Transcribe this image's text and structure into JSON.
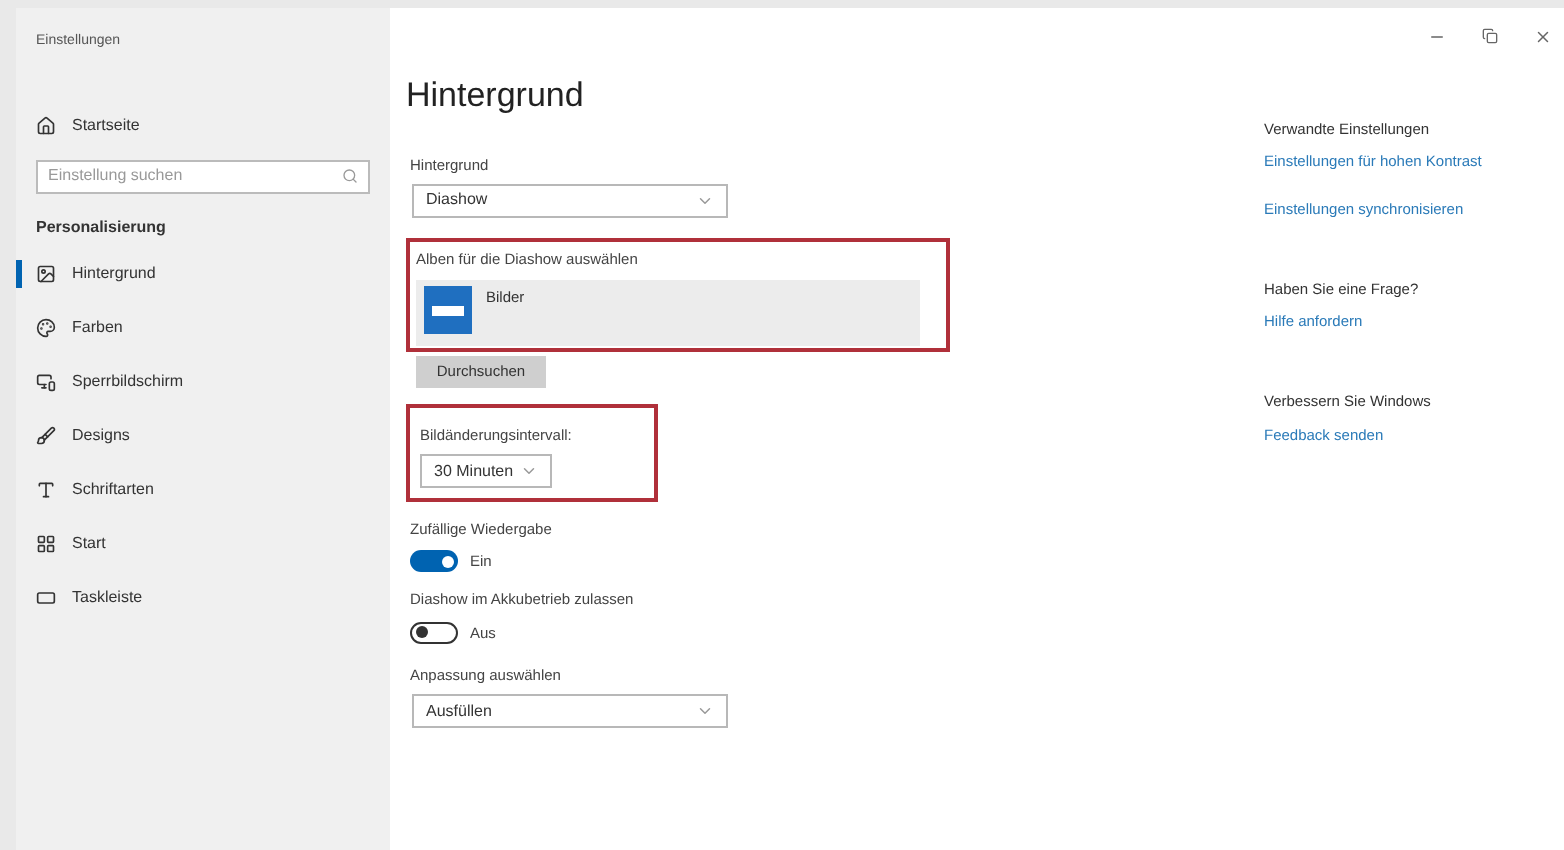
{
  "window": {
    "title": "Einstellungen"
  },
  "sidebar": {
    "home": "Startseite",
    "search": {
      "placeholder": "Einstellung suchen"
    },
    "section": "Personalisierung",
    "items": [
      {
        "label": "Hintergrund",
        "selected": true
      },
      {
        "label": "Farben",
        "selected": false
      },
      {
        "label": "Sperrbildschirm",
        "selected": false
      },
      {
        "label": "Designs",
        "selected": false
      },
      {
        "label": "Schriftarten",
        "selected": false
      },
      {
        "label": "Start",
        "selected": false
      },
      {
        "label": "Taskleiste",
        "selected": false
      }
    ]
  },
  "main": {
    "title": "Hintergrund",
    "background": {
      "label": "Hintergrund",
      "value": "Diashow"
    },
    "albums": {
      "label": "Alben für die Diashow auswählen",
      "highlighted": true,
      "items": [
        {
          "name": "Bilder"
        }
      ],
      "browse": "Durchsuchen"
    },
    "interval": {
      "label": "Bildänderungsintervall:",
      "value": "30 Minuten",
      "highlighted": true
    },
    "toggles": [
      {
        "label": "Zufällige Wiedergabe",
        "on": true,
        "state": "Ein"
      },
      {
        "label": "Diashow im Akkubetrieb zulassen",
        "on": false,
        "state": "Aus"
      }
    ],
    "fit": {
      "label": "Anpassung auswählen",
      "value": "Ausfüllen"
    }
  },
  "related": [
    {
      "heading": "Verwandte Einstellungen",
      "links": [
        "Einstellungen für hohen Kontrast",
        "Einstellungen synchronisieren"
      ]
    },
    {
      "heading": "Haben Sie eine Frage?",
      "links": [
        "Hilfe anfordern"
      ]
    },
    {
      "heading": "Verbessern Sie Windows",
      "links": [
        "Feedback senden"
      ]
    }
  ]
}
